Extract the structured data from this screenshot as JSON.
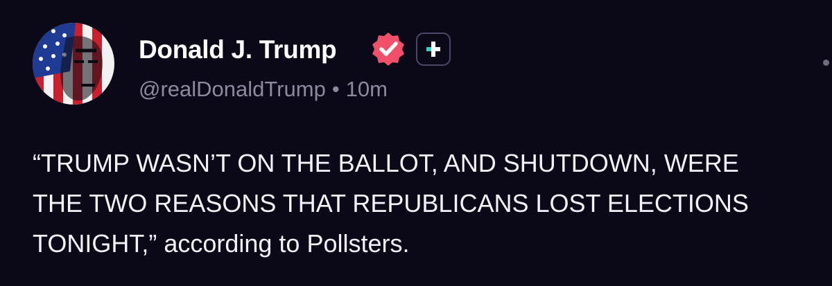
{
  "post": {
    "author": {
      "name": "Donald J. Trump",
      "handle": "@realDonaldTrump",
      "verified": true
    },
    "separator": "•",
    "time": "10m",
    "text_lines": [
      "“TRUMP WASN’T ON THE BALLOT, AND SHUTDOWN, WERE",
      "THE TWO REASONS THAT REPUBLICANS LOST ELECTIONS",
      "TONIGHT,” according to Pollsters."
    ]
  },
  "icons": {
    "verified": "verified-badge-icon",
    "follow": "plus-icon",
    "more": "more-options-icon"
  },
  "colors": {
    "background": "#0b0918",
    "name_text": "#ffffff",
    "meta_text": "#8c8a9e",
    "verified_badge": "#f0506a",
    "follow_plus_accent": "#2fd4c2"
  }
}
